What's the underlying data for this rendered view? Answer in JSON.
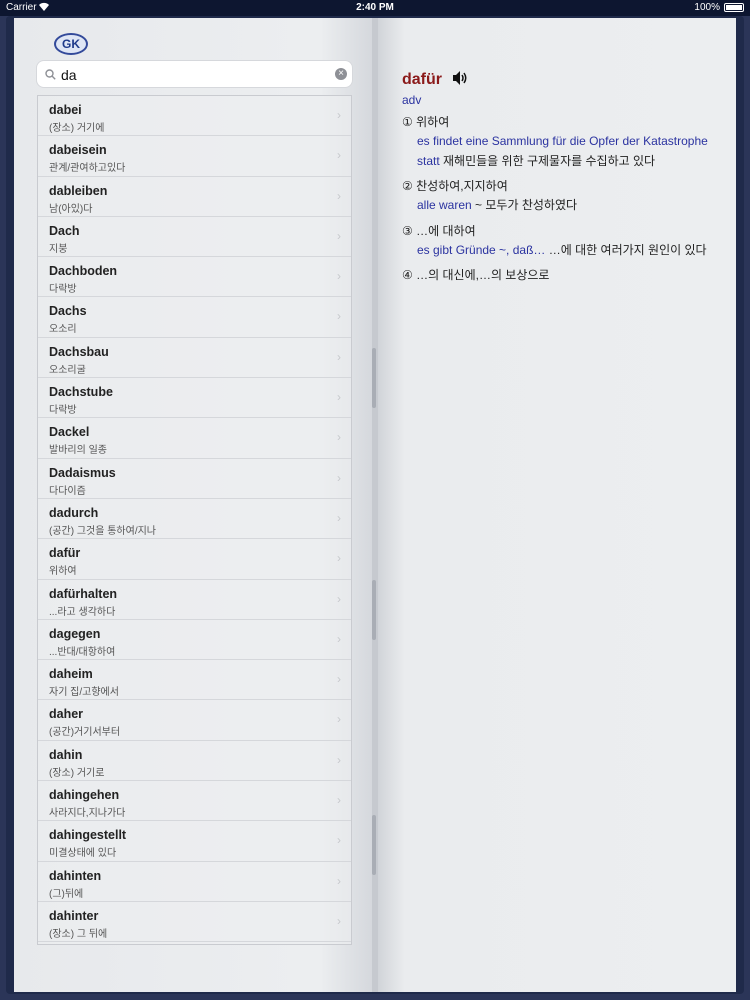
{
  "status_bar": {
    "carrier": "Carrier",
    "time": "2:40 PM",
    "battery": "100%"
  },
  "logo_text": "GK",
  "search": {
    "value": "da"
  },
  "word_list": [
    {
      "word": "dabei",
      "gloss": "(장소) 거기에"
    },
    {
      "word": "dabeisein",
      "gloss": "관계/관여하고있다"
    },
    {
      "word": "dableiben",
      "gloss": "남(아있)다"
    },
    {
      "word": "Dach",
      "gloss": "지붕"
    },
    {
      "word": "Dachboden",
      "gloss": "다락방"
    },
    {
      "word": "Dachs",
      "gloss": "오소리"
    },
    {
      "word": "Dachsbau",
      "gloss": "오소리굴"
    },
    {
      "word": "Dachstube",
      "gloss": "다락방"
    },
    {
      "word": "Dackel",
      "gloss": "발바리의 일종"
    },
    {
      "word": "Dadaismus",
      "gloss": "다다이즘"
    },
    {
      "word": "dadurch",
      "gloss": "(공간) 그것을 통하여/지나"
    },
    {
      "word": "dafür",
      "gloss": "위하여"
    },
    {
      "word": "dafürhalten",
      "gloss": "...라고 생각하다"
    },
    {
      "word": "dagegen",
      "gloss": "...반대/대항하여"
    },
    {
      "word": "daheim",
      "gloss": "자기 집/고향에서"
    },
    {
      "word": "daher",
      "gloss": "(공간)거기서부터"
    },
    {
      "word": "dahin",
      "gloss": "(장소) 거기로"
    },
    {
      "word": "dahingehen",
      "gloss": "사라지다,지나가다"
    },
    {
      "word": "dahingestellt",
      "gloss": "미결상태에 있다"
    },
    {
      "word": "dahinten",
      "gloss": "(그)뒤에"
    },
    {
      "word": "dahinter",
      "gloss": "(장소) 그 뒤에"
    }
  ],
  "entry": {
    "headword": "dafür",
    "pos": "adv",
    "senses": [
      {
        "num": "①",
        "text": "위하여"
      },
      {
        "num": "②",
        "text": "찬성하여,지지하여"
      },
      {
        "num": "③",
        "text": "…에 대하여"
      },
      {
        "num": "④",
        "text": "…의 대신에,…의 보상으로"
      }
    ],
    "examples": [
      {
        "de": "es findet eine Sammlung für die Opfer der Katastrophe statt",
        "ko": " 재해민들을 위한 구제물자를 수집하고 있다"
      },
      {
        "de": "alle waren",
        "ko": " ~ 모두가 찬성하였다"
      },
      {
        "de": "es gibt Gründe ~, daß…",
        "ko": " …에 대한 여러가지 원인이 있다"
      }
    ]
  }
}
